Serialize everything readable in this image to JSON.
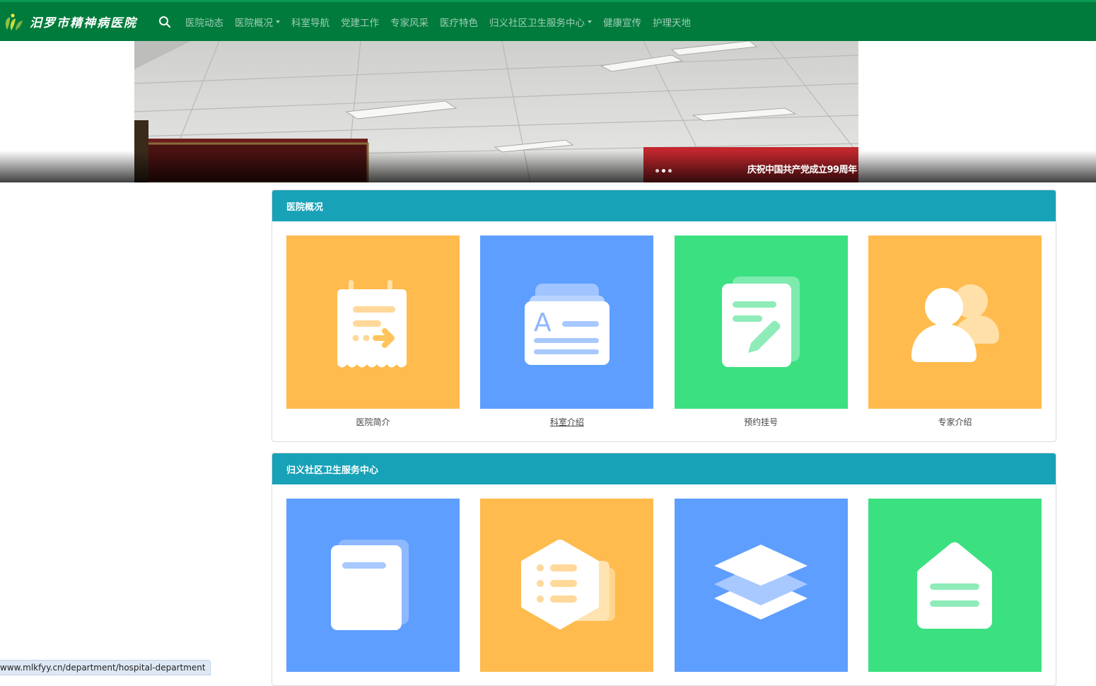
{
  "brand": {
    "name": "汨罗市精神病医院"
  },
  "nav": {
    "items": [
      {
        "label": "医院动态",
        "dropdown": false
      },
      {
        "label": "医院概况",
        "dropdown": true
      },
      {
        "label": "科室导航",
        "dropdown": false
      },
      {
        "label": "党建工作",
        "dropdown": false
      },
      {
        "label": "专家风采",
        "dropdown": false
      },
      {
        "label": "医疗特色",
        "dropdown": false
      },
      {
        "label": "归义社区卫生服务中心",
        "dropdown": true
      },
      {
        "label": "健康宣传",
        "dropdown": false
      },
      {
        "label": "护理天地",
        "dropdown": false
      }
    ]
  },
  "banner": {
    "caption": "庆祝中国共产党成立99周年",
    "slide_count": 3,
    "active_slide": 1
  },
  "sections": [
    {
      "title": "医院概况",
      "tiles": [
        {
          "label": "医院简介",
          "color": "#ffbb4d",
          "icon": "document-arrow-icon"
        },
        {
          "label": "科室介绍",
          "color": "#5e9eff",
          "icon": "text-card-icon"
        },
        {
          "label": "预约挂号",
          "color": "#3be081",
          "icon": "edit-note-icon"
        },
        {
          "label": "专家介绍",
          "color": "#ffbb4d",
          "icon": "users-icon"
        }
      ]
    },
    {
      "title": "归义社区卫生服务中心",
      "tiles": [
        {
          "label": "",
          "color": "#5e9eff",
          "icon": "notebook-icon"
        },
        {
          "label": "",
          "color": "#ffbb4d",
          "icon": "list-hexagon-icon"
        },
        {
          "label": "",
          "color": "#5e9eff",
          "icon": "layers-icon"
        },
        {
          "label": "",
          "color": "#3be081",
          "icon": "home-icon"
        }
      ]
    }
  ],
  "status_bar": {
    "url": "www.mlkfyy.cn/department/hospital-department"
  },
  "colors": {
    "nav_bg": "#007b3c",
    "section_header": "#17a2b8"
  }
}
